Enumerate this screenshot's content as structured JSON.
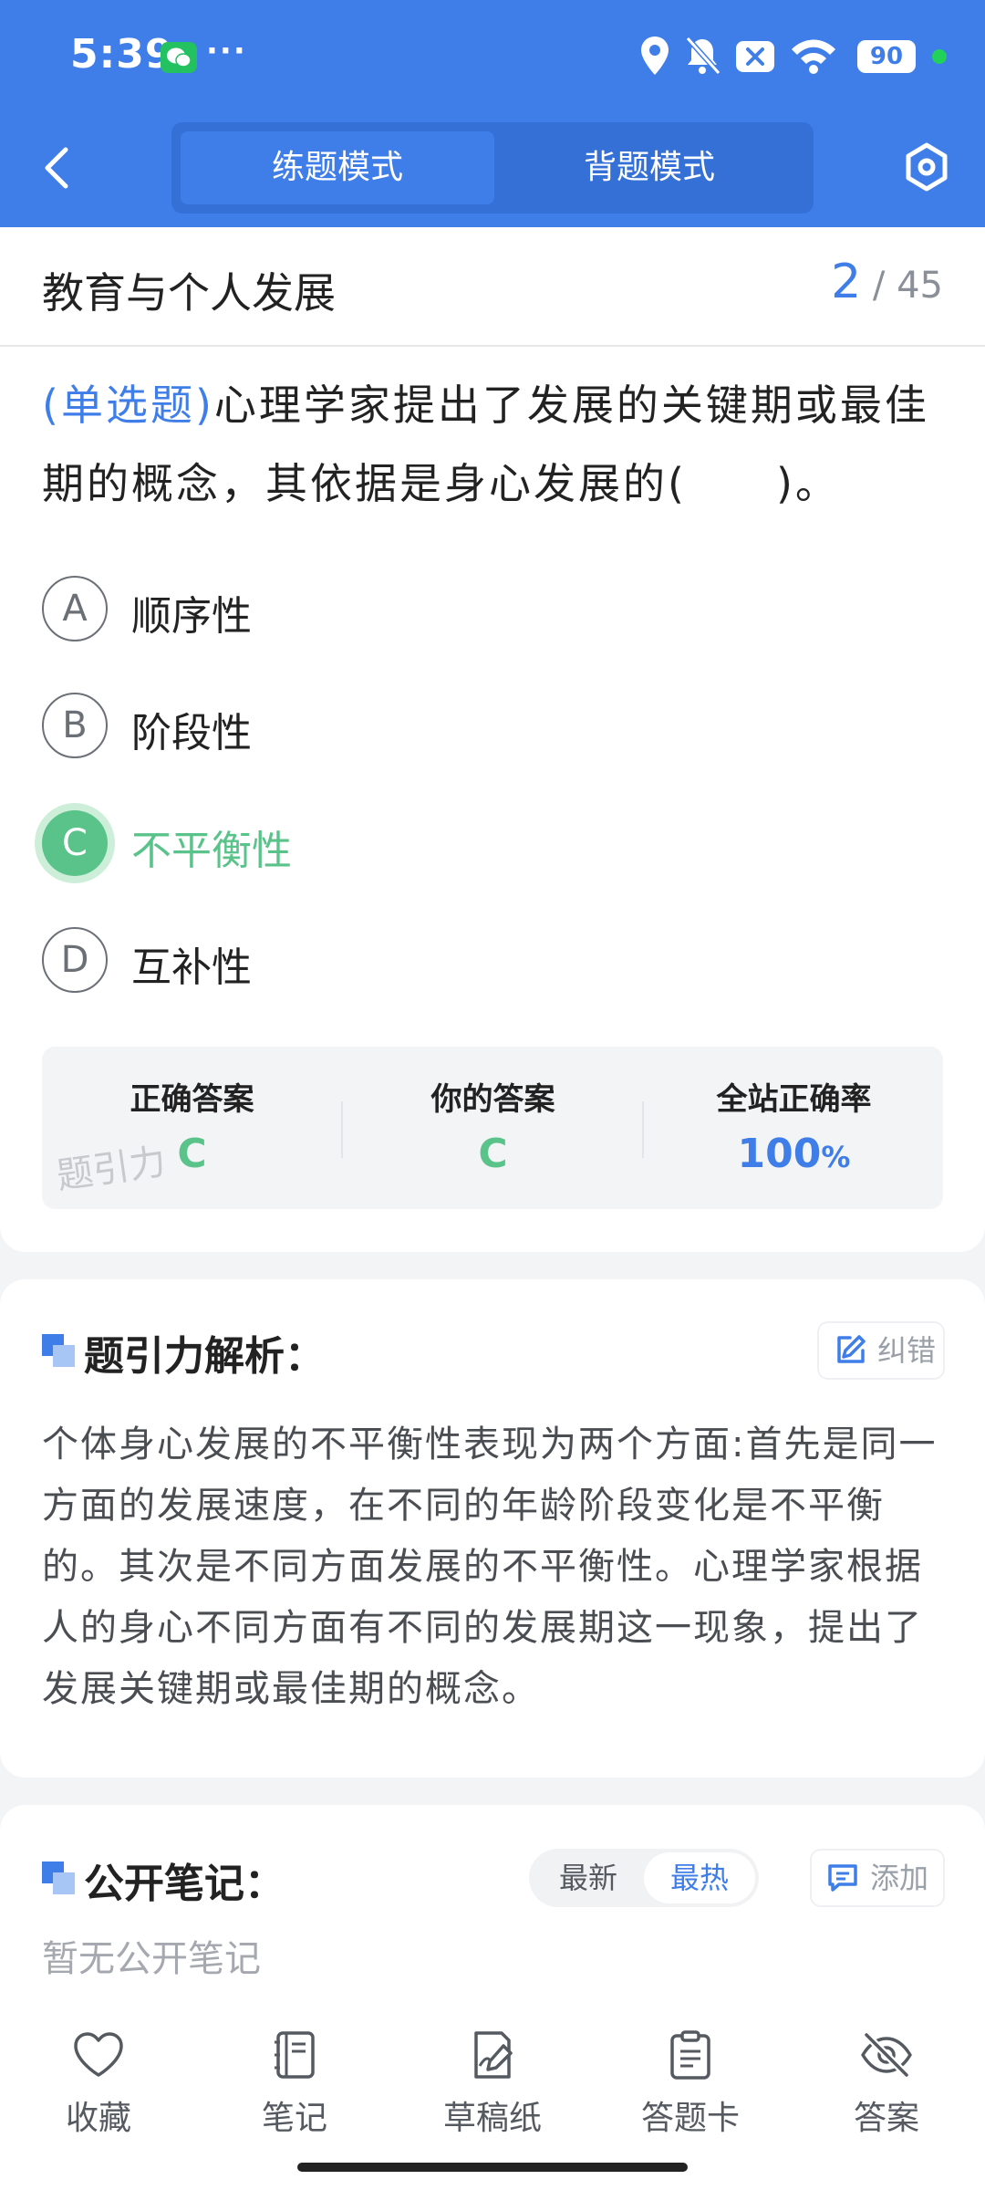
{
  "status_bar": {
    "time": "5:39",
    "more": "···",
    "battery": "90"
  },
  "header": {
    "modes": [
      "练题模式",
      "背题模式"
    ],
    "active_mode": "练题模式"
  },
  "topic": {
    "title": "教育与个人发展",
    "current": "2",
    "total": "45",
    "separator": "/"
  },
  "question": {
    "type_label": "(单选题)",
    "text": "心理学家提出了发展的关键期或最佳期的概念，其依据是身心发展的(　　)。",
    "options": [
      {
        "letter": "A",
        "text": "顺序性"
      },
      {
        "letter": "B",
        "text": "阶段性"
      },
      {
        "letter": "C",
        "text": "不平衡性",
        "state": "correct"
      },
      {
        "letter": "D",
        "text": "互补性"
      }
    ]
  },
  "answer_stats": {
    "correct_label": "正确答案",
    "correct_value": "C",
    "yours_label": "你的答案",
    "yours_value": "C",
    "rate_label": "全站正确率",
    "rate_value": "100",
    "rate_unit": "%",
    "watermark": "题引力"
  },
  "analysis": {
    "title": "题引力解析：",
    "report_label": "纠错",
    "text": "个体身心发展的不平衡性表现为两个方面:首先是同一方面的发展速度，在不同的年龄阶段变化是不平衡的。其次是不同方面发展的不平衡性。心理学家根据人的身心不同方面有不同的发展期这一现象，提出了发展关键期或最佳期的概念。"
  },
  "notes": {
    "title": "公开笔记：",
    "sort_options": [
      "最新",
      "最热"
    ],
    "active_sort": "最热",
    "add_label": "添加",
    "empty_text": "暂无公开笔记"
  },
  "bottom_nav": [
    {
      "icon": "heart-icon",
      "label": "收藏"
    },
    {
      "icon": "notebook-icon",
      "label": "笔记"
    },
    {
      "icon": "draft-paper-icon",
      "label": "草稿纸"
    },
    {
      "icon": "answer-sheet-icon",
      "label": "答题卡"
    },
    {
      "icon": "eye-off-icon",
      "label": "答案"
    }
  ],
  "colors": {
    "primary": "#3f7ee8",
    "correct": "#5ac38a",
    "text": "#222222",
    "muted": "#a5a9af"
  }
}
